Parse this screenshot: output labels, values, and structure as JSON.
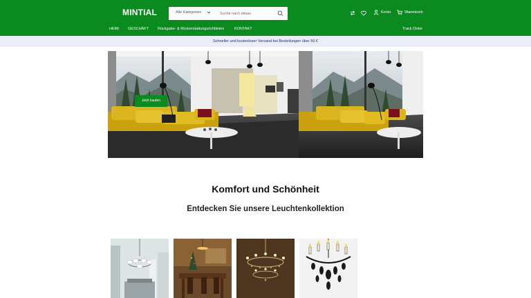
{
  "header": {
    "logo": "MINTIAL",
    "search_category": "Alle Kategorien",
    "search_placeholder": "Suche nach etwas",
    "account_label": "Konto",
    "cart_label": "Warenkorb"
  },
  "nav": {
    "items": [
      {
        "label": "HEIM"
      },
      {
        "label": "GESCHÄFT"
      },
      {
        "label": "Rückgabe- & Rückerstattungsrichtlinien"
      },
      {
        "label": "KONTAKT"
      }
    ],
    "track_order": "Track Order"
  },
  "promo": {
    "text": "Schneller und kostenloser Versand bei Bestellungen über 50 €"
  },
  "hero": {
    "cta_label": "Jetzt kaufen"
  },
  "main": {
    "heading": "Komfort und Schönheit",
    "subheading": "Entdecken Sie unsere Leuchtenkollektion"
  },
  "colors": {
    "brand_green": "#0a8a1f",
    "promo_bg": "#e9eef7",
    "promo_text": "#1f2f6b"
  },
  "icons": [
    "chevron-down-icon",
    "search-icon",
    "compare-icon",
    "heart-icon",
    "user-icon",
    "cart-icon"
  ]
}
